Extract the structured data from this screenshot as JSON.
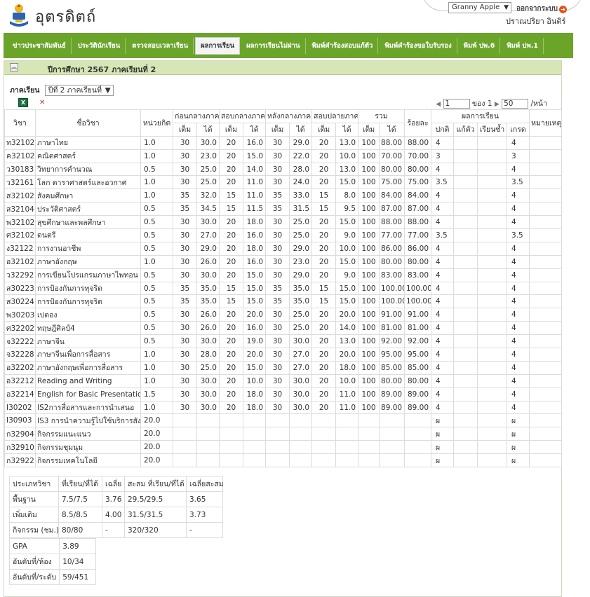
{
  "header": {
    "brand": "อุตรดิตถ์",
    "user_selector": "Granny Apple",
    "logout_label": "ออกจากระบบ",
    "username": "ปราณปริยา  อินติร์"
  },
  "nav": [
    {
      "label": "ข่าวประชาสัมพันธ์"
    },
    {
      "label": "ประวัตินักเรียน"
    },
    {
      "label": "ตรวจสอบเวลาเรียน"
    },
    {
      "label": "ผลการเรียน",
      "active": true
    },
    {
      "label": "ผลการเรียนไม่ผ่าน"
    },
    {
      "label": "พิมพ์คำร้องสอบแก้ตัว"
    },
    {
      "label": "พิมพ์คำร้องขอใบรับรอง"
    },
    {
      "label": "พิมพ์ ปพ.6"
    },
    {
      "label": "พิมพ์ ปพ.1"
    }
  ],
  "panel": {
    "title": "ปีการศึกษา  2567  ภาคเรียนที่  2",
    "semester_label": "ภาคเรียน",
    "semester_value": "ปีที่ 2 ภาคเรียนที่",
    "pager": {
      "page": "1",
      "of_label": "ของ",
      "total": "1",
      "per_page": "50",
      "per_page_label": "/หน้า"
    }
  },
  "table": {
    "headers": {
      "code": "วิชา",
      "name": "ชื่อวิชา",
      "credit": "หน่วยกิต",
      "before_mid": "ก่อนกลางภาค",
      "mid": "สอบกลางภาค",
      "after_mid": "หลังกลางภาค",
      "final": "สอบปลายภาค",
      "total": "รวม",
      "percent": "ร้อยละ",
      "result": "ผลการเรียน",
      "remark": "หมายเหตุ",
      "full": "เต็ม",
      "got": "ได้",
      "normal": "ปกติ",
      "fix": "แก้ตัว",
      "repeat": "เรียนซ้ำ",
      "grade": "เกรด"
    },
    "rows": [
      [
        "ท32102",
        "ภาษาไทย",
        "1.0",
        "30",
        "30.0",
        "20",
        "16.0",
        "30",
        "29.0",
        "20",
        "13.0",
        "100",
        "88.00",
        "88.00",
        "4",
        "",
        "",
        "4"
      ],
      [
        "ค32102",
        "คณิตศาสตร์",
        "1.0",
        "30",
        "23.0",
        "20",
        "15.0",
        "30",
        "22.0",
        "20",
        "10.0",
        "100",
        "70.00",
        "70.00",
        "3",
        "",
        "",
        "3"
      ],
      [
        "ว30183",
        "วิทยาการคำนวณ",
        "0.5",
        "30",
        "25.0",
        "20",
        "14.0",
        "30",
        "28.0",
        "20",
        "13.0",
        "100",
        "80.00",
        "80.00",
        "4",
        "",
        "",
        "4"
      ],
      [
        "ว32161",
        "โลก ดาราศาสตร์และอวกาศ",
        "1.0",
        "30",
        "25.0",
        "20",
        "11.0",
        "30",
        "24.0",
        "20",
        "15.0",
        "100",
        "75.00",
        "75.00",
        "3.5",
        "",
        "",
        "3.5"
      ],
      [
        "ส32102",
        "สังคมศึกษา",
        "1.0",
        "35",
        "32.0",
        "15",
        "11.0",
        "35",
        "33.0",
        "15",
        "8.0",
        "100",
        "84.00",
        "84.00",
        "4",
        "",
        "",
        "4"
      ],
      [
        "ส32104",
        "ประวัติศาสตร์",
        "0.5",
        "35",
        "34.5",
        "15",
        "11.5",
        "35",
        "31.5",
        "15",
        "9.5",
        "100",
        "87.00",
        "87.00",
        "4",
        "",
        "",
        "4"
      ],
      [
        "พ32102",
        "สุขศึกษาและพลศึกษา",
        "0.5",
        "30",
        "30.0",
        "20",
        "18.0",
        "30",
        "25.0",
        "20",
        "15.0",
        "100",
        "88.00",
        "88.00",
        "4",
        "",
        "",
        "4"
      ],
      [
        "ศ32102",
        "ดนตรี",
        "0.5",
        "30",
        "27.0",
        "20",
        "16.0",
        "30",
        "25.0",
        "20",
        "9.0",
        "100",
        "77.00",
        "77.00",
        "3.5",
        "",
        "",
        "3.5"
      ],
      [
        "ง32122",
        "การงานอาชีพ",
        "0.5",
        "30",
        "29.0",
        "20",
        "18.0",
        "30",
        "29.0",
        "20",
        "10.0",
        "100",
        "86.00",
        "86.00",
        "4",
        "",
        "",
        "4"
      ],
      [
        "อ32102",
        "ภาษาอังกฤษ",
        "1.0",
        "30",
        "26.0",
        "20",
        "16.0",
        "30",
        "23.0",
        "20",
        "15.0",
        "100",
        "80.00",
        "80.00",
        "4",
        "",
        "",
        "4"
      ],
      [
        "ว32292",
        "การเขียนโปรแกรมภาษาไพทอน",
        "0.5",
        "30",
        "30.0",
        "20",
        "15.0",
        "30",
        "29.0",
        "20",
        "9.0",
        "100",
        "83.00",
        "83.00",
        "4",
        "",
        "",
        "4"
      ],
      [
        "ส30223",
        "การป้องกันการทุจริต",
        "0.5",
        "35",
        "35.0",
        "15",
        "15.0",
        "35",
        "35.0",
        "15",
        "15.0",
        "100",
        "100.00",
        "100.00",
        "4",
        "",
        "",
        "4"
      ],
      [
        "ส30224",
        "การป้องกันการทุจริต",
        "0.5",
        "35",
        "35.0",
        "15",
        "15.0",
        "35",
        "35.0",
        "15",
        "15.0",
        "100",
        "100.00",
        "100.00",
        "4",
        "",
        "",
        "4"
      ],
      [
        "พ30203",
        "เปตอง",
        "0.5",
        "30",
        "26.0",
        "20",
        "20.0",
        "30",
        "25.0",
        "20",
        "20.0",
        "100",
        "91.00",
        "91.00",
        "4",
        "",
        "",
        "4"
      ],
      [
        "ศ32202",
        "ทฤษฎีศิลป์4",
        "0.5",
        "30",
        "26.0",
        "20",
        "16.0",
        "30",
        "25.0",
        "20",
        "14.0",
        "100",
        "81.00",
        "81.00",
        "4",
        "",
        "",
        "4"
      ],
      [
        "จ32222",
        "ภาษาจีน",
        "0.5",
        "30",
        "30.0",
        "20",
        "19.0",
        "30",
        "30.0",
        "20",
        "13.0",
        "100",
        "92.00",
        "92.00",
        "4",
        "",
        "",
        "4"
      ],
      [
        "จ32228",
        "ภาษาจีนเพื่อการสื่อสาร",
        "1.0",
        "30",
        "28.0",
        "20",
        "20.0",
        "30",
        "27.0",
        "20",
        "20.0",
        "100",
        "95.00",
        "95.00",
        "4",
        "",
        "",
        "4"
      ],
      [
        "อ32202",
        "ภาษาอังกฤษเพื่อการสื่อสาร",
        "1.0",
        "30",
        "25.0",
        "20",
        "15.0",
        "30",
        "27.0",
        "20",
        "18.0",
        "100",
        "85.00",
        "85.00",
        "4",
        "",
        "",
        "4"
      ],
      [
        "อ32212",
        "Reading and Writing",
        "1.0",
        "30",
        "30.0",
        "20",
        "10.0",
        "30",
        "30.0",
        "20",
        "10.0",
        "100",
        "80.00",
        "80.00",
        "4",
        "",
        "",
        "4"
      ],
      [
        "อ32214",
        "English for Basic Presentation",
        "1.5",
        "30",
        "30.0",
        "20",
        "18.0",
        "30",
        "30.0",
        "20",
        "11.0",
        "100",
        "89.00",
        "89.00",
        "4",
        "",
        "",
        "4"
      ],
      [
        "I30202",
        "IS2การสื่อสารและการนำเสนอ",
        "1.0",
        "30",
        "30.0",
        "20",
        "18.0",
        "30",
        "30.0",
        "20",
        "11.0",
        "100",
        "89.00",
        "89.00",
        "4",
        "",
        "",
        "4"
      ],
      [
        "I30903",
        "IS3 การนำความรู้ไปใช้บริการสังคม",
        "20.0",
        "",
        "",
        "",
        "",
        "",
        "",
        "",
        "",
        "",
        "",
        "",
        "ผ",
        "",
        "",
        "ผ"
      ],
      [
        "ก32904",
        "กิจกรรมแนะแนว",
        "20.0",
        "",
        "",
        "",
        "",
        "",
        "",
        "",
        "",
        "",
        "",
        "",
        "ผ",
        "",
        "",
        "ผ"
      ],
      [
        "ก32910",
        "กิจกรรมชุมนุม",
        "20.0",
        "",
        "",
        "",
        "",
        "",
        "",
        "",
        "",
        "",
        "",
        "",
        "ผ",
        "",
        "",
        "ผ"
      ],
      [
        "ก32922",
        "กิจกรรมเทคโนโลยี",
        "20.0",
        "",
        "",
        "",
        "",
        "",
        "",
        "",
        "",
        "",
        "",
        "",
        "ผ",
        "",
        "",
        "ผ"
      ]
    ]
  },
  "summary": {
    "headers": [
      "ประเภทวิชา",
      "ที่เรียน/ที่ได้",
      "เฉลี่ย",
      "สะสม ที่เรียน/ที่ได้",
      "เฉลี่ยสะสม"
    ],
    "rows": [
      [
        "พื้นฐาน",
        "7.5/7.5",
        "3.76",
        "29.5/29.5",
        "3.65"
      ],
      [
        "เพิ่มเติม",
        "8.5/8.5",
        "4.00",
        "31.5/31.5",
        "3.73"
      ],
      [
        "กิจกรรม (ชม.)",
        "80/80",
        "-",
        "320/320",
        "-"
      ]
    ],
    "gpa": [
      [
        "GPA",
        "3.89"
      ],
      [
        "อันดับที่/ห้อง",
        "10/34"
      ],
      [
        "อันดับที่/ระดับ",
        "59/451"
      ]
    ]
  },
  "colors": {
    "nav_bg": "#6aa52a",
    "panel_head": "#d6e6b4",
    "logout_icon": "#e8531a"
  },
  "icons": [
    "logo-emblem-icon",
    "logout-icon",
    "collapse-icon",
    "excel-export-icon",
    "clear-filter-icon",
    "prev-page-icon",
    "next-page-icon"
  ]
}
